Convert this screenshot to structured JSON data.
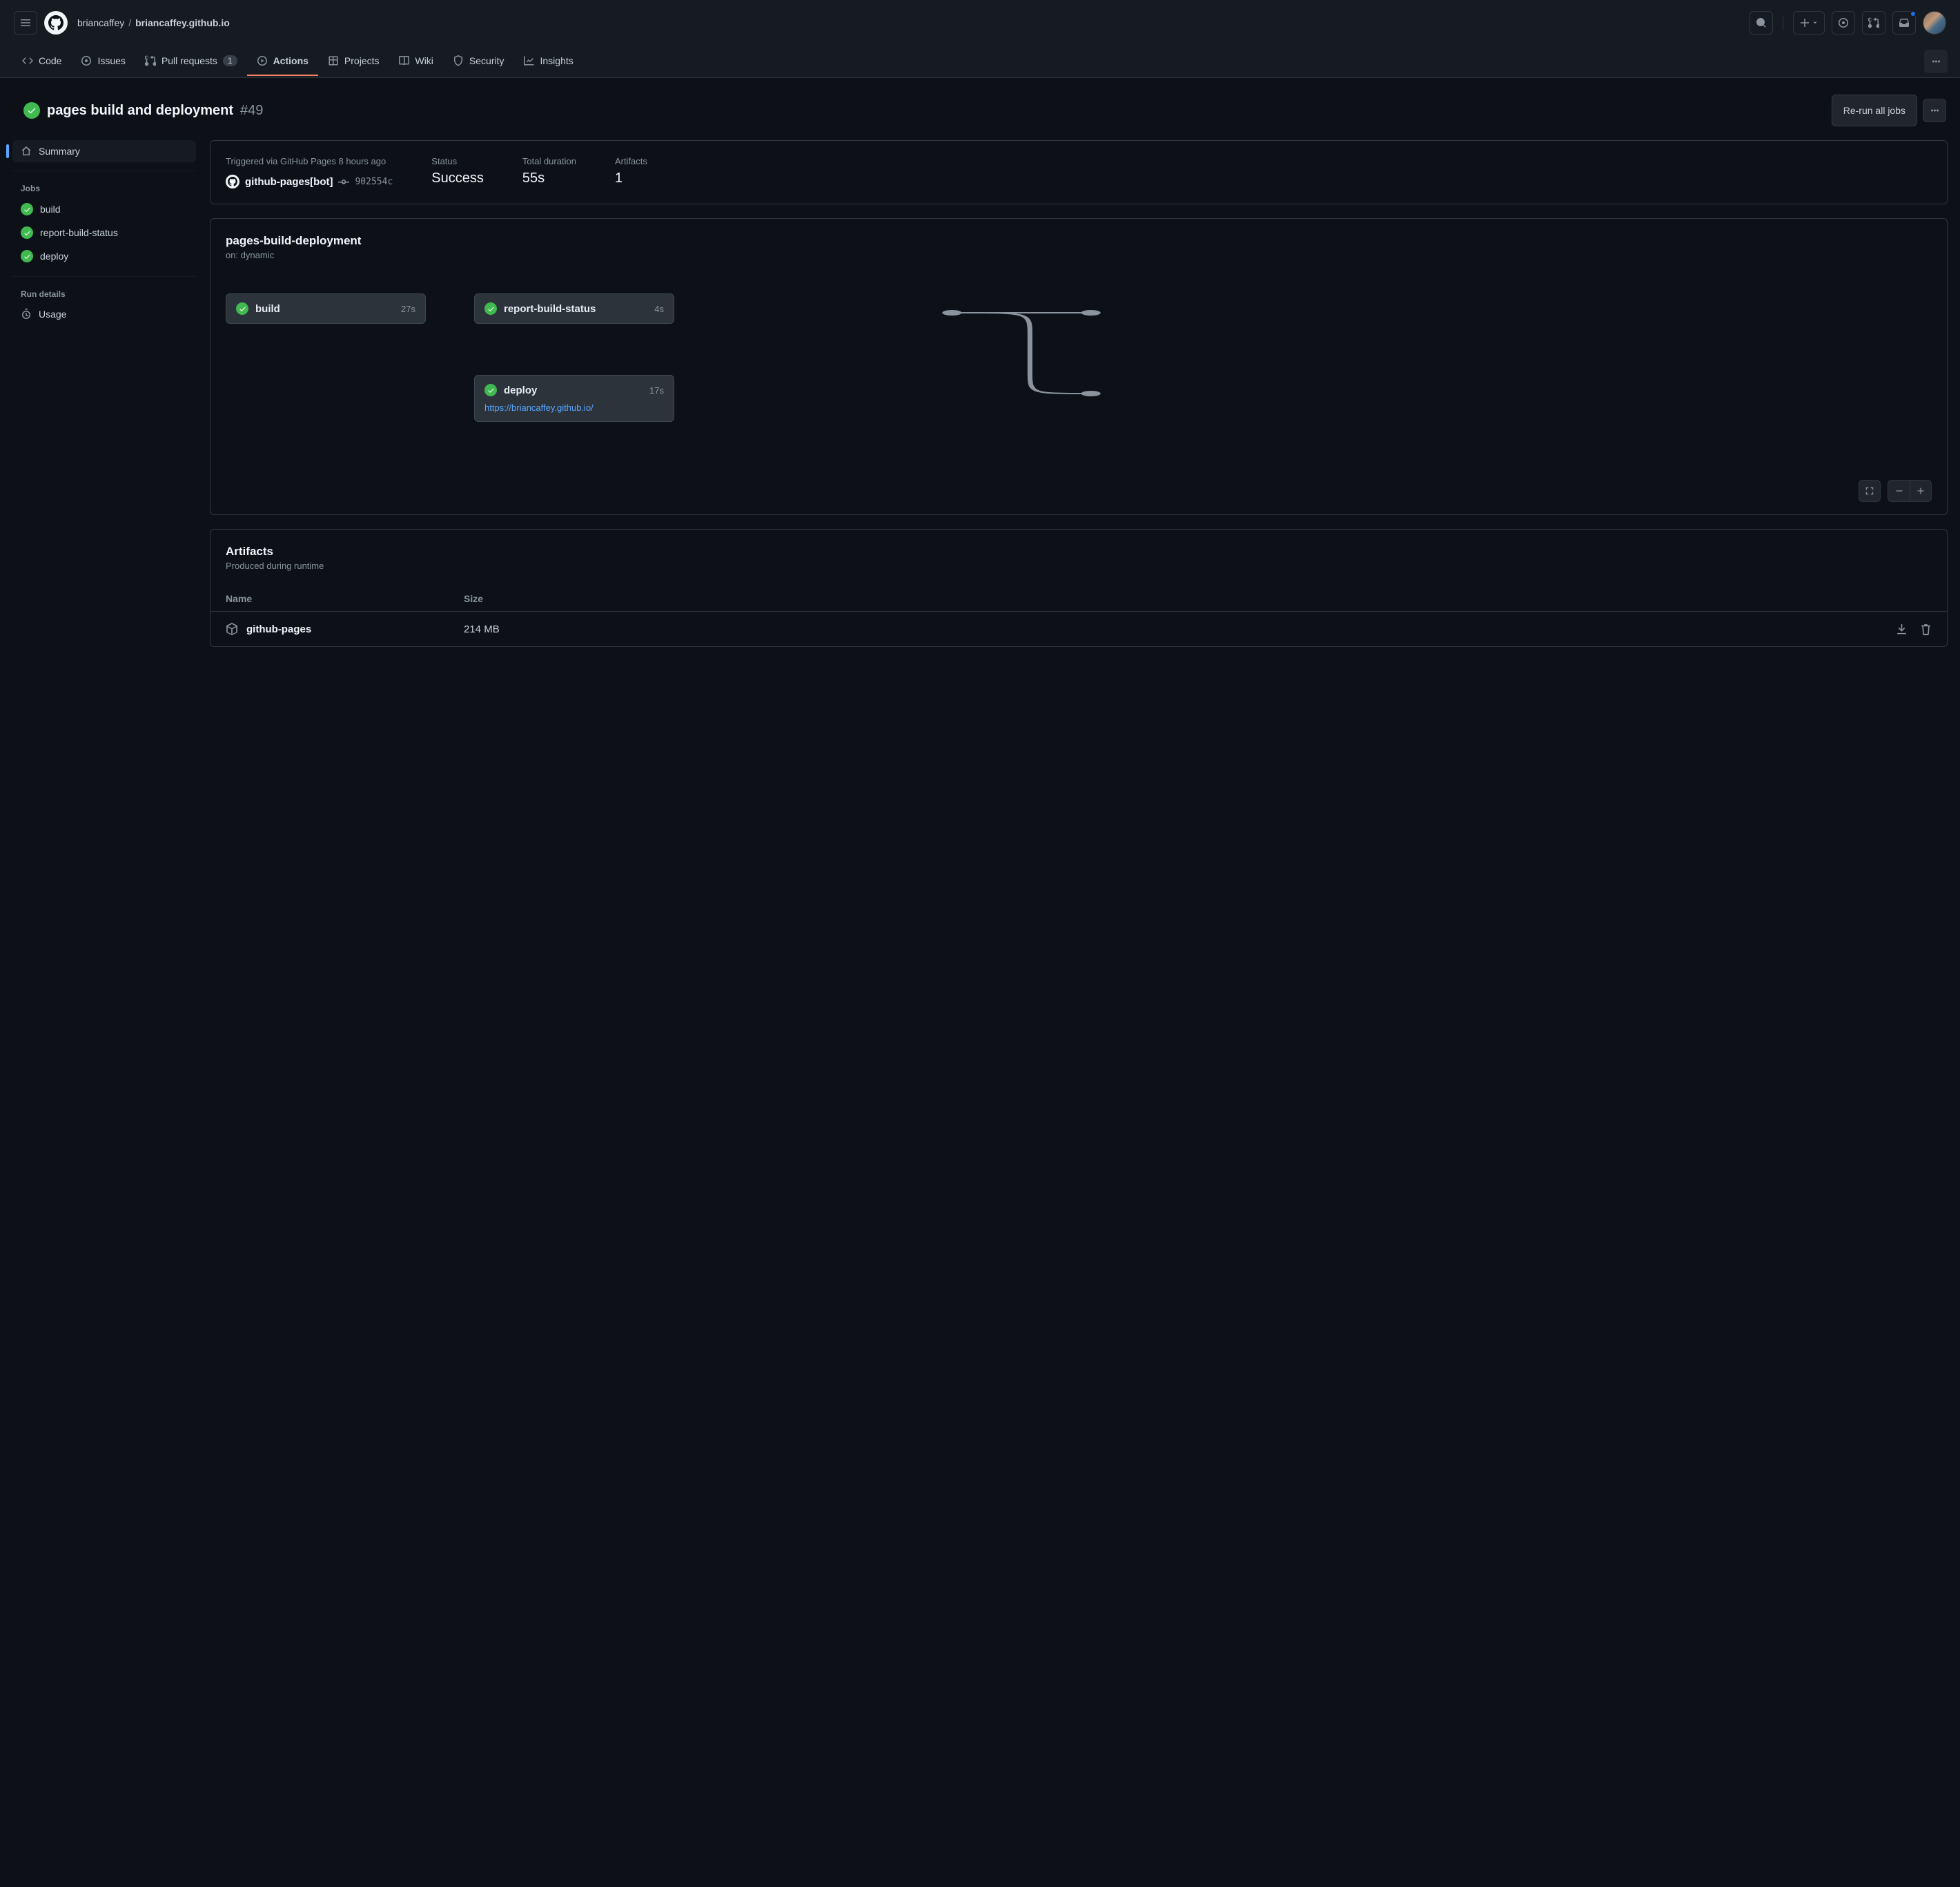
{
  "breadcrumb": {
    "owner": "briancaffey",
    "repo": "briancaffey.github.io"
  },
  "tabs": {
    "code": "Code",
    "issues": "Issues",
    "pull_requests": "Pull requests",
    "pull_requests_count": "1",
    "actions": "Actions",
    "projects": "Projects",
    "wiki": "Wiki",
    "security": "Security",
    "insights": "Insights"
  },
  "page_title": {
    "name": "pages build and deployment",
    "number": "#49",
    "rerun_label": "Re-run all jobs"
  },
  "sidebar": {
    "summary": "Summary",
    "jobs_heading": "Jobs",
    "jobs": [
      {
        "name": "build"
      },
      {
        "name": "report-build-status"
      },
      {
        "name": "deploy"
      }
    ],
    "run_details_heading": "Run details",
    "usage": "Usage"
  },
  "meta": {
    "triggered_text": "Triggered via GitHub Pages 8 hours ago",
    "actor": "github-pages[bot]",
    "commit_sha": "902554c",
    "status_label": "Status",
    "status_value": "Success",
    "duration_label": "Total duration",
    "duration_value": "55s",
    "artifacts_label": "Artifacts",
    "artifacts_value": "1"
  },
  "workflow": {
    "title": "pages-build-deployment",
    "subtitle": "on: dynamic",
    "nodes": {
      "build": {
        "name": "build",
        "time": "27s"
      },
      "report": {
        "name": "report-build-status",
        "time": "4s"
      },
      "deploy": {
        "name": "deploy",
        "time": "17s",
        "url": "https://briancaffey.github.io/"
      }
    }
  },
  "artifacts": {
    "title": "Artifacts",
    "subtitle": "Produced during runtime",
    "col_name": "Name",
    "col_size": "Size",
    "rows": [
      {
        "name": "github-pages",
        "size": "214 MB"
      }
    ]
  }
}
